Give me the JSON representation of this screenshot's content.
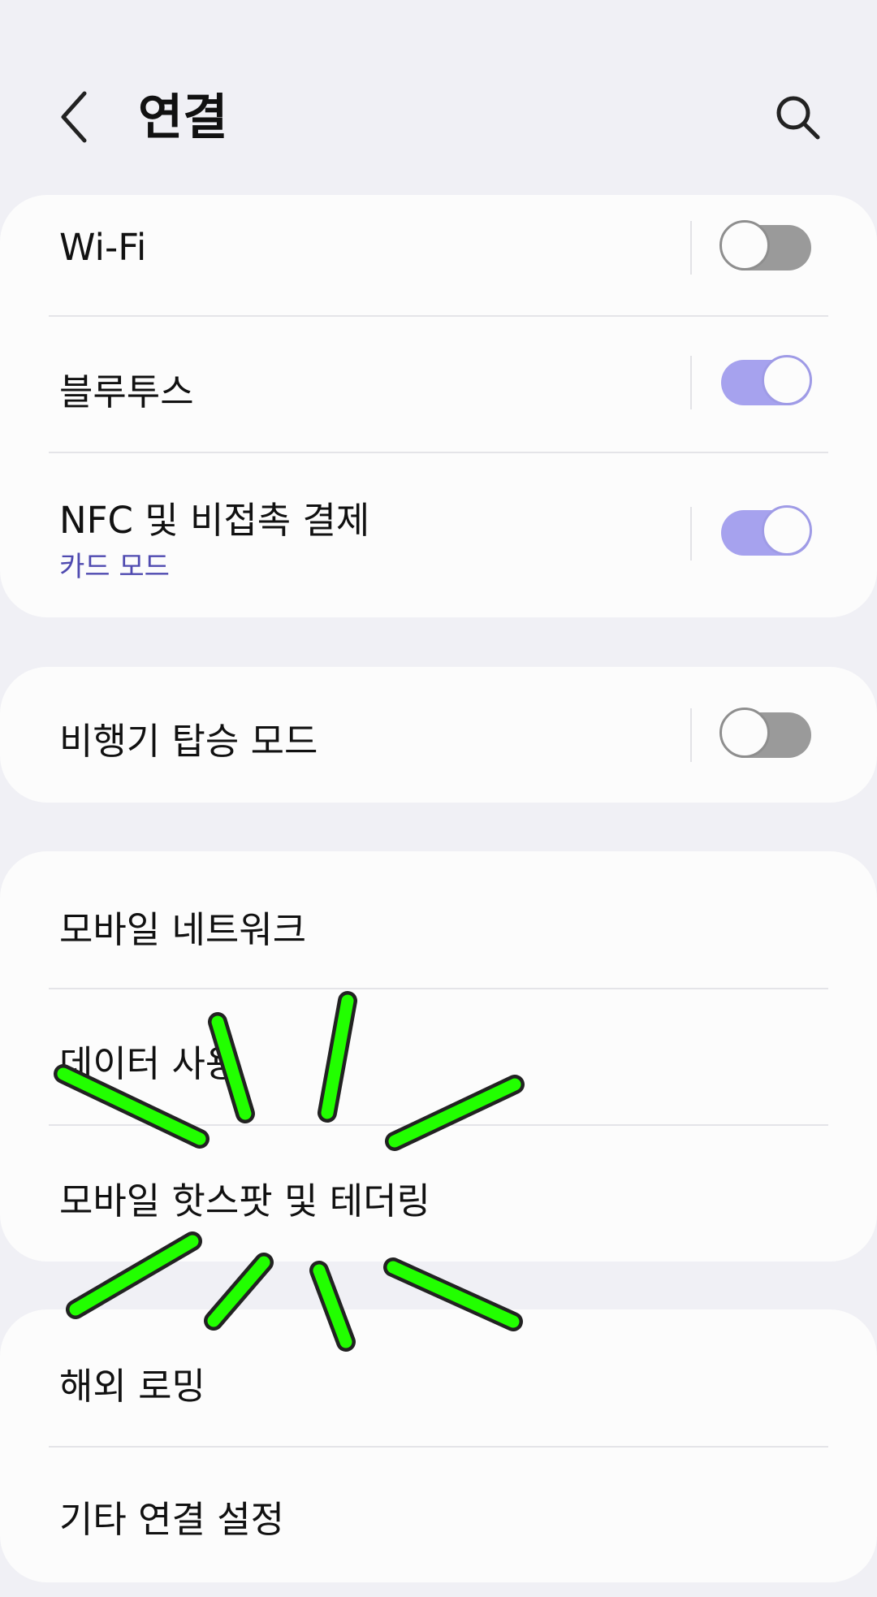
{
  "header": {
    "title": "연결",
    "back_icon": "chevron-left-icon",
    "search_icon": "search-icon"
  },
  "groups": [
    {
      "items": [
        {
          "label": "Wi-Fi",
          "toggle": false
        },
        {
          "label": "블루투스",
          "toggle": true
        },
        {
          "label": "NFC 및 비접촉 결제",
          "sub": "카드 모드",
          "toggle": true
        }
      ]
    },
    {
      "items": [
        {
          "label": "비행기 탑승 모드",
          "toggle": false
        }
      ]
    },
    {
      "items": [
        {
          "label": "모바일 네트워크"
        },
        {
          "label": "데이터 사용"
        },
        {
          "label": "모바일 핫스팟 및 테더링"
        }
      ]
    },
    {
      "items": [
        {
          "label": "해외 로밍"
        },
        {
          "label": "기타 연결 설정"
        }
      ]
    }
  ],
  "colors": {
    "background": "#f0f0f5",
    "card": "#fcfcfc",
    "accent": "#a6a2ee",
    "sub_text": "#4f4ab0",
    "toggle_off": "#9a9a9a",
    "tap_indicator": "#22ff00"
  }
}
